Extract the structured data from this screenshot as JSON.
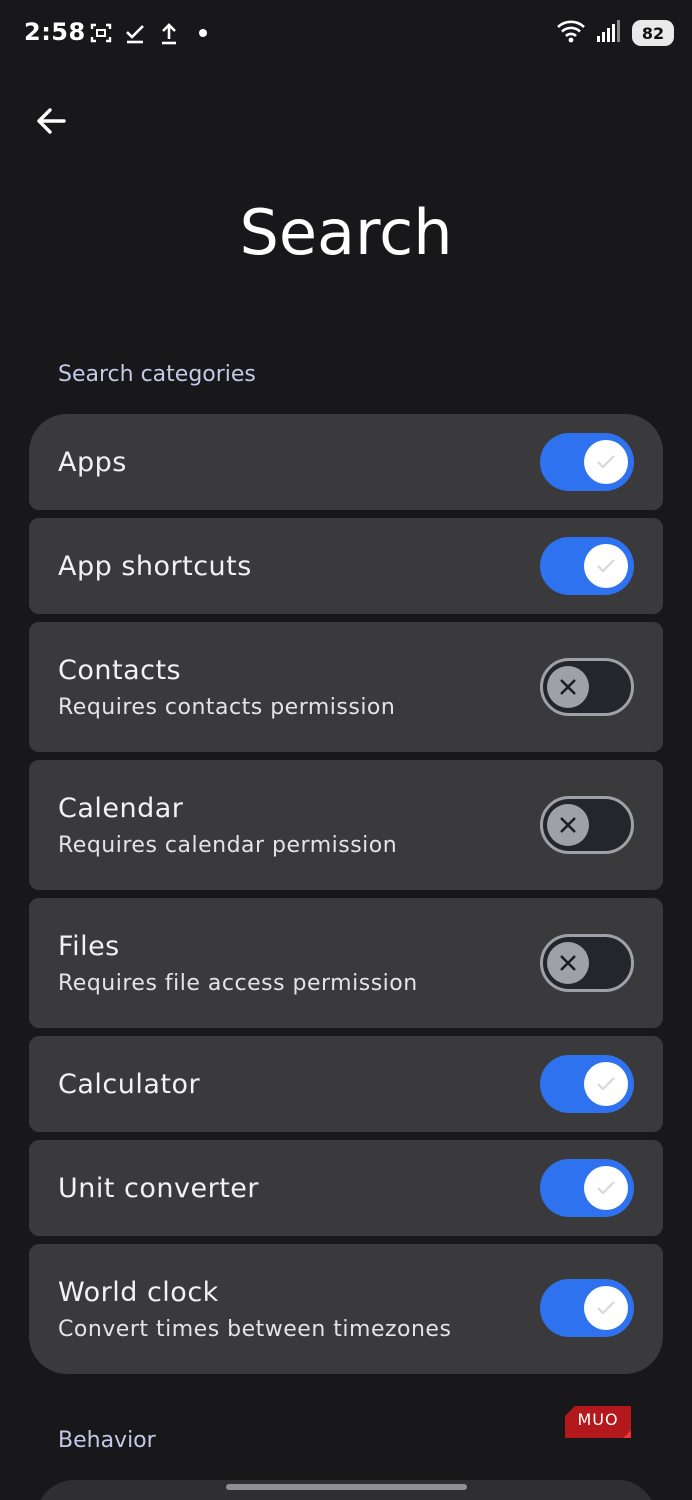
{
  "status_bar": {
    "time": "2:58",
    "battery": "82",
    "icons_left": [
      "screenshot-icon",
      "check-icon",
      "upload-icon",
      "dot-icon"
    ],
    "icons_right": [
      "wifi-icon",
      "cellular-signal-icon",
      "battery-icon"
    ]
  },
  "header": {
    "back_icon": "arrow-left-icon",
    "title": "Search"
  },
  "sections": {
    "search_categories": "Search categories",
    "behavior": "Behavior"
  },
  "settings": [
    {
      "title": "Apps",
      "subtitle": "",
      "enabled": true
    },
    {
      "title": "App shortcuts",
      "subtitle": "",
      "enabled": true
    },
    {
      "title": "Contacts",
      "subtitle": "Requires contacts permission",
      "enabled": false
    },
    {
      "title": "Calendar",
      "subtitle": "Requires calendar permission",
      "enabled": false
    },
    {
      "title": "Files",
      "subtitle": "Requires file access permission",
      "enabled": false
    },
    {
      "title": "Calculator",
      "subtitle": "",
      "enabled": true
    },
    {
      "title": "Unit converter",
      "subtitle": "",
      "enabled": true
    },
    {
      "title": "World clock",
      "subtitle": "Convert times between timezones",
      "enabled": true
    }
  ],
  "colors": {
    "background": "#18181b",
    "card": "#3a3a3d",
    "accent": "#2f72f0",
    "section_label": "#c5c8e6"
  },
  "watermark": "MUO"
}
